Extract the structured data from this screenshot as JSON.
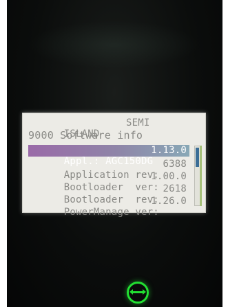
{
  "display": {
    "header_left": "ISLAND",
    "header_right": "SEMI",
    "title": "9000 Software info",
    "rows": [
      {
        "label": "Appl.: AGC150DG",
        "value": "1.13.0",
        "selected": true
      },
      {
        "label": "Application rev:",
        "value": "6388",
        "selected": false
      },
      {
        "label": "Bootloader  ver:",
        "value": "1.00.0",
        "selected": false
      },
      {
        "label": "Bootloader  rev:",
        "value": "2618",
        "selected": false
      },
      {
        "label": "PowerManage ver:",
        "value": "1.26.0",
        "selected": false
      }
    ],
    "scroll_position": 0.0
  },
  "controls": {
    "power_button_icon": "horizontal-double-arrow-icon",
    "power_button_color": "#22e032"
  },
  "colors": {
    "lcd_background": "#ecebe6",
    "lcd_text": "#8a8a86",
    "selection_highlight": "#9a6aa8",
    "scroll_thumb": "#3b6d96"
  }
}
